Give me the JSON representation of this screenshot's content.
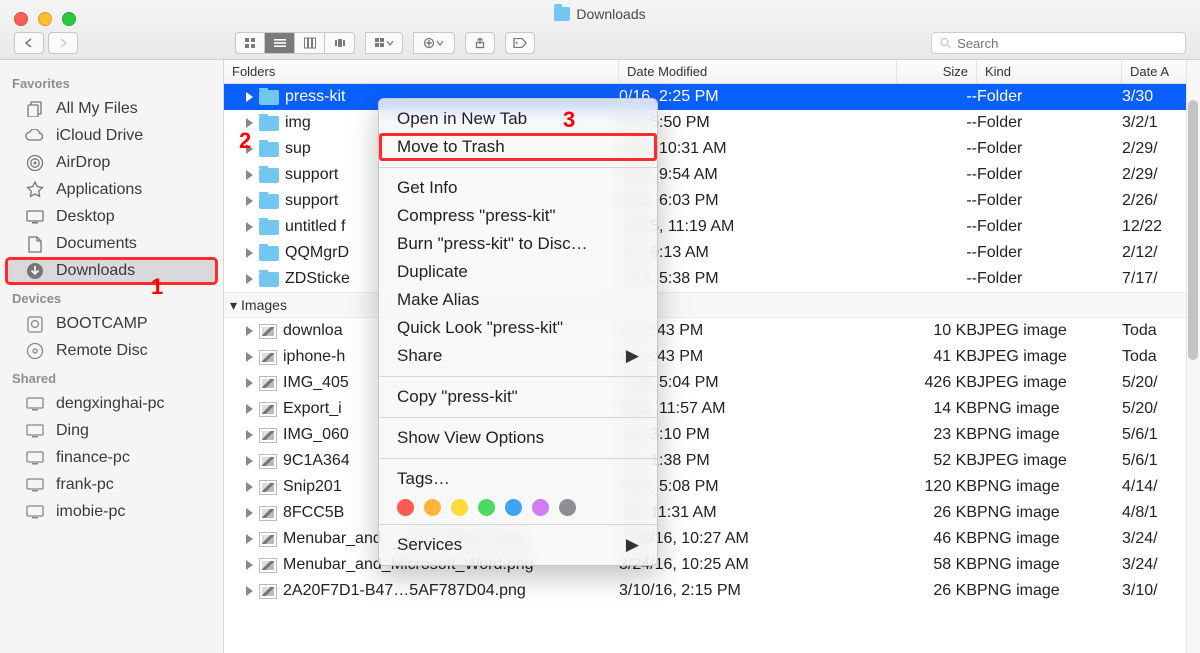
{
  "window_title": "Downloads",
  "search_placeholder": "Search",
  "sidebar": {
    "sections": [
      {
        "label": "Favorites",
        "items": [
          {
            "id": "all-my-files",
            "label": "All My Files"
          },
          {
            "id": "icloud-drive",
            "label": "iCloud Drive"
          },
          {
            "id": "airdrop",
            "label": "AirDrop"
          },
          {
            "id": "applications",
            "label": "Applications"
          },
          {
            "id": "desktop",
            "label": "Desktop"
          },
          {
            "id": "documents",
            "label": "Documents"
          },
          {
            "id": "downloads",
            "label": "Downloads",
            "selected": true
          }
        ]
      },
      {
        "label": "Devices",
        "items": [
          {
            "id": "bootcamp",
            "label": "BOOTCAMP"
          },
          {
            "id": "remote-disc",
            "label": "Remote Disc"
          }
        ]
      },
      {
        "label": "Shared",
        "items": [
          {
            "id": "dengxinghai-pc",
            "label": "dengxinghai-pc"
          },
          {
            "id": "ding",
            "label": "Ding"
          },
          {
            "id": "finance-pc",
            "label": "finance-pc"
          },
          {
            "id": "frank-pc",
            "label": "frank-pc"
          },
          {
            "id": "imobie-pc",
            "label": "imobie-pc"
          }
        ]
      }
    ]
  },
  "columns": {
    "name": "Folders",
    "mod": "Date Modified",
    "size": "Size",
    "kind": "Kind",
    "date": "Date A"
  },
  "sections": [
    {
      "label": "Folders",
      "rows": [
        {
          "name": "press-kit",
          "mod": "0/16, 2:25 PM",
          "size": "--",
          "kind": "Folder",
          "date": "3/30",
          "selected": true
        },
        {
          "name": "img",
          "mod": "/16, 5:50 PM",
          "size": "--",
          "kind": "Folder",
          "date": "3/2/1"
        },
        {
          "name": "sup",
          "mod": "9/16, 10:31 AM",
          "size": "--",
          "kind": "Folder",
          "date": "2/29/"
        },
        {
          "name": "support",
          "mod": "9/16, 9:54 AM",
          "size": "--",
          "kind": "Folder",
          "date": "2/29/"
        },
        {
          "name": "support",
          "mod": "6/16, 6:03 PM",
          "size": "--",
          "kind": "Folder",
          "date": "2/26/"
        },
        {
          "name": "untitled f",
          "mod": "22/15, 11:19 AM",
          "size": "--",
          "kind": "Folder",
          "date": "12/22"
        },
        {
          "name": "QQMgrD",
          "mod": "/15, 9:13 AM",
          "size": "--",
          "kind": "Folder",
          "date": "2/12/"
        },
        {
          "name": "ZDSticke",
          "mod": "7/13, 5:38 PM",
          "size": "--",
          "kind": "Folder",
          "date": "7/17/"
        }
      ]
    },
    {
      "label": "Images",
      "rows": [
        {
          "name": "downloa",
          "mod": "ay, 2:43 PM",
          "size": "10 KB",
          "kind": "JPEG image",
          "date": "Toda"
        },
        {
          "name": "iphone-h",
          "mod": "ay, 2:43 PM",
          "size": "41 KB",
          "kind": "JPEG image",
          "date": "Toda"
        },
        {
          "name": "IMG_405",
          "mod": "0/16, 5:04 PM",
          "size": "426 KB",
          "kind": "JPEG image",
          "date": "5/20/"
        },
        {
          "name": "Export_i",
          "mod": "0/16, 11:57 AM",
          "size": "14 KB",
          "kind": "PNG image",
          "date": "5/20/"
        },
        {
          "name": "IMG_060",
          "mod": "/16, 3:10 PM",
          "size": "23 KB",
          "kind": "PNG image",
          "date": "5/6/1"
        },
        {
          "name": "9C1A364",
          "mod": "/16, 1:38 PM",
          "size": "52 KB",
          "kind": "JPEG image",
          "date": "5/6/1"
        },
        {
          "name": "Snip201",
          "mod": "4/16, 5:08 PM",
          "size": "120 KB",
          "kind": "PNG image",
          "date": "4/14/"
        },
        {
          "name": "8FCC5B",
          "mod": "/16, 11:31 AM",
          "size": "26 KB",
          "kind": "PNG image",
          "date": "4/8/1"
        },
        {
          "name": "Menubar_and_…soft_Word-1.png",
          "mod": "3/24/16, 10:27 AM",
          "size": "46 KB",
          "kind": "PNG image",
          "date": "3/24/"
        },
        {
          "name": "Menubar_and_Microsoft_Word.png",
          "mod": "3/24/16, 10:25 AM",
          "size": "58 KB",
          "kind": "PNG image",
          "date": "3/24/"
        },
        {
          "name": "2A20F7D1-B47…5AF787D04.png",
          "mod": "3/10/16, 2:15 PM",
          "size": "26 KB",
          "kind": "PNG image",
          "date": "3/10/"
        }
      ]
    }
  ],
  "context_menu": {
    "items": [
      {
        "label": "Open in New Tab"
      },
      {
        "label": "Move to Trash",
        "highlighted": true
      },
      {
        "separator": true
      },
      {
        "label": "Get Info"
      },
      {
        "label": "Compress \"press-kit\""
      },
      {
        "label": "Burn \"press-kit\" to Disc…"
      },
      {
        "label": "Duplicate"
      },
      {
        "label": "Make Alias"
      },
      {
        "label": "Quick Look \"press-kit\""
      },
      {
        "label": "Share",
        "submenu": true
      },
      {
        "separator": true
      },
      {
        "label": "Copy \"press-kit\""
      },
      {
        "separator": true
      },
      {
        "label": "Show View Options"
      },
      {
        "separator": true
      },
      {
        "label": "Tags…"
      },
      {
        "tags": true
      },
      {
        "separator": true
      },
      {
        "label": "Services",
        "submenu": true
      }
    ],
    "tag_colors": [
      "#ff5b52",
      "#ffb638",
      "#ffdb3c",
      "#4dd964",
      "#3aa6f5",
      "#cf7df3",
      "#8e8e93"
    ]
  },
  "annotations": {
    "1": "1",
    "2": "2",
    "3": "3"
  }
}
